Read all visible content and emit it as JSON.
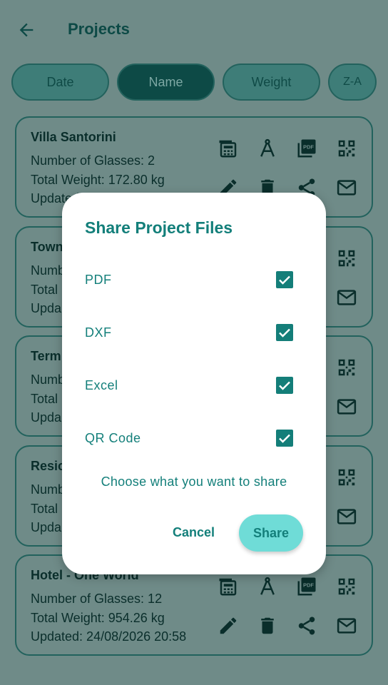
{
  "app_bar": {
    "title": "Projects",
    "back_icon": "arrow-left-icon"
  },
  "sort_chips": [
    {
      "label": "Date",
      "active": false
    },
    {
      "label": "Name",
      "active": true
    },
    {
      "label": "Weight",
      "active": false
    },
    {
      "label": "Z-A",
      "active": false
    }
  ],
  "projects": [
    {
      "name": "Villa Santorini",
      "glasses": "Number of Glasses: 2",
      "weight": "Total Weight: 172.80 kg",
      "updated": "Updated: "
    },
    {
      "name": "Town",
      "glasses": "Numb",
      "weight": "Total",
      "updated": "Upda"
    },
    {
      "name": "Term",
      "glasses": "Numb",
      "weight": "Total",
      "updated": "Upda"
    },
    {
      "name": "Resic",
      "glasses": "Numb",
      "weight": "Total",
      "updated": "Upda"
    },
    {
      "name": "Hotel - One World",
      "glasses": "Number of Glasses: 12",
      "weight": "Total Weight: 954.26 kg",
      "updated": "Updated: 24/08/2026 20:58"
    }
  ],
  "card_actions": [
    "calculator-icon",
    "compass-icon",
    "pdf-icon",
    "qr-code-icon",
    "edit-icon",
    "delete-icon",
    "share-icon",
    "email-icon"
  ],
  "dialog": {
    "title": "Share Project Files",
    "options": [
      {
        "label": "PDF",
        "checked": true
      },
      {
        "label": "DXF",
        "checked": true
      },
      {
        "label": "Excel",
        "checked": true
      },
      {
        "label": "QR Code",
        "checked": true
      }
    ],
    "hint": "Choose what you want to share",
    "cancel_label": "Cancel",
    "share_label": "Share"
  },
  "colors": {
    "scrim_bg": "#6f8b88",
    "primary": "#137f7a",
    "share_button": "#6fdcd7",
    "dialog_bg": "#ffffff"
  }
}
